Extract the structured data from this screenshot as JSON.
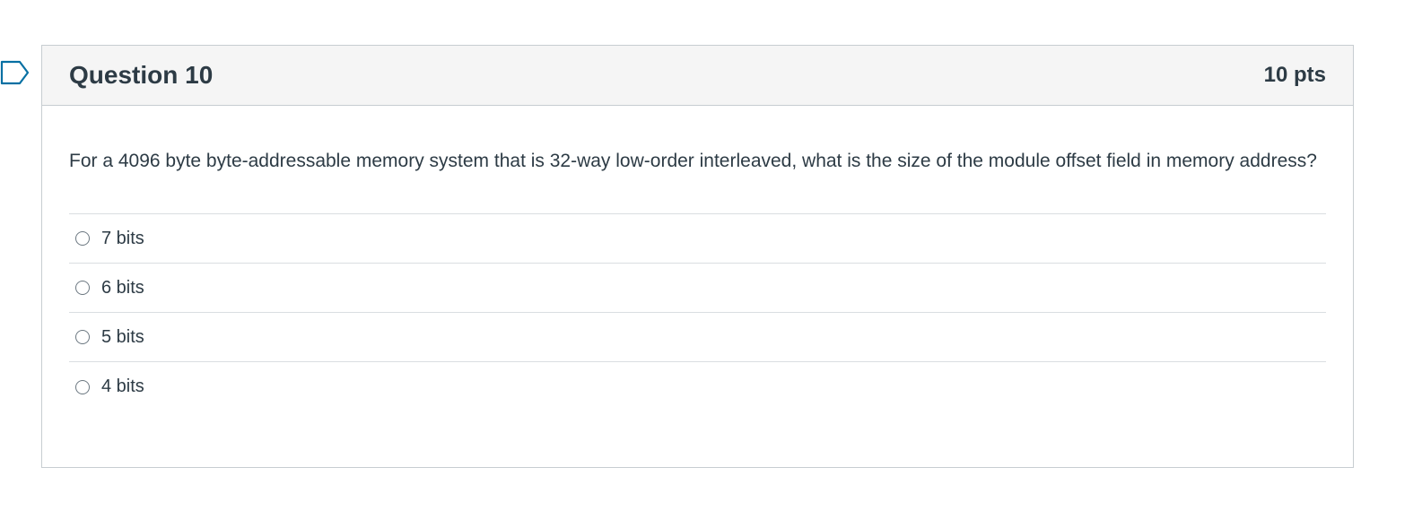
{
  "question": {
    "title": "Question 10",
    "points": "10 pts",
    "text": "For a 4096 byte byte-addressable memory system that is 32-way low-order interleaved, what is the size of the module offset field in memory address?",
    "answers": [
      {
        "label": "7 bits"
      },
      {
        "label": "6 bits"
      },
      {
        "label": "5 bits"
      },
      {
        "label": "4 bits"
      }
    ]
  },
  "colors": {
    "header_bg": "#f5f5f5",
    "border": "#c7cdd1",
    "text": "#2d3b45",
    "flag": "#0770a3"
  },
  "icons": {
    "flag": "bookmark-flag-icon"
  }
}
